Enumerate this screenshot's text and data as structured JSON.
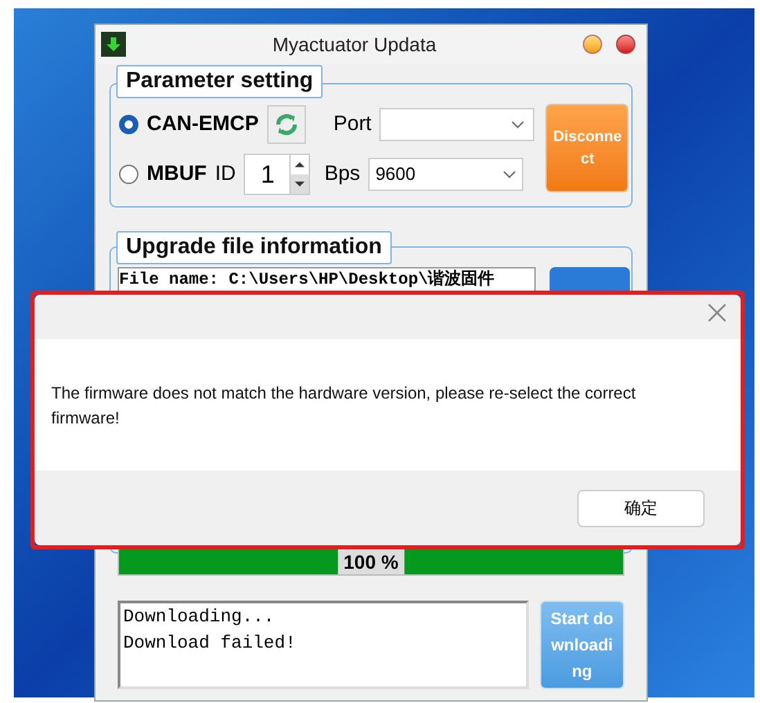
{
  "window": {
    "title": "Myactuator Updata"
  },
  "parameter_setting": {
    "title": "Parameter setting",
    "modes": [
      {
        "label": "CAN-EMCP",
        "selected": true
      },
      {
        "label": "MBUF",
        "selected": false
      }
    ],
    "id_label": "ID",
    "id_value": "1",
    "port_label": "Port",
    "bps_label": "Bps",
    "bps_value": "9600",
    "connect_button": "Disconnect"
  },
  "upgrade_file": {
    "title": "Upgrade file information",
    "file_name": "File name:  C:\\Users\\HP\\Desktop\\谐波固件"
  },
  "progress": {
    "level": 1,
    "reading": "100 %"
  },
  "log": {
    "lines": [
      "Downloading...",
      "Download failed!"
    ]
  },
  "start_button": {
    "label": "Start downloading",
    "disabled": true
  },
  "dialog": {
    "message": "The firmware does not match the hardware version, please re-select the correct firmware!",
    "ok_button": "确定"
  }
}
